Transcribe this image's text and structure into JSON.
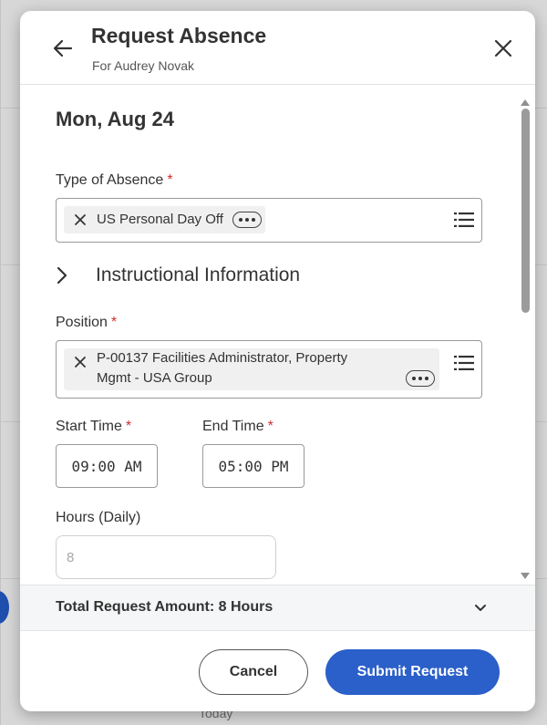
{
  "background": {
    "today_label": "Today",
    "event_color": "#1f4fae"
  },
  "header": {
    "title": "Request Absence",
    "subtitle": "For Audrey Novak",
    "back_icon": "arrow-left-icon",
    "close_icon": "close-icon"
  },
  "form": {
    "date_heading": "Mon, Aug 24",
    "type_of_absence": {
      "label": "Type of Absence",
      "required_mark": "*",
      "selected": "US Personal Day Off"
    },
    "instructional_information": {
      "label": "Instructional Information"
    },
    "position": {
      "label": "Position",
      "required_mark": "*",
      "selected_line1": "P-00137 Facilities Administrator, Property",
      "selected_line2": "Mgmt - USA Group"
    },
    "start_time": {
      "label": "Start Time",
      "required_mark": "*",
      "value": "09:00 AM"
    },
    "end_time": {
      "label": "End Time",
      "required_mark": "*",
      "value": "05:00 PM"
    },
    "hours_daily": {
      "label": "Hours (Daily)",
      "value": "8"
    }
  },
  "summary": {
    "total_label": "Total Request Amount: 8 Hours"
  },
  "footer": {
    "cancel_label": "Cancel",
    "submit_label": "Submit Request"
  },
  "colors": {
    "primary": "#2b5fc9",
    "required": "#d12f2f",
    "text": "#333333"
  }
}
